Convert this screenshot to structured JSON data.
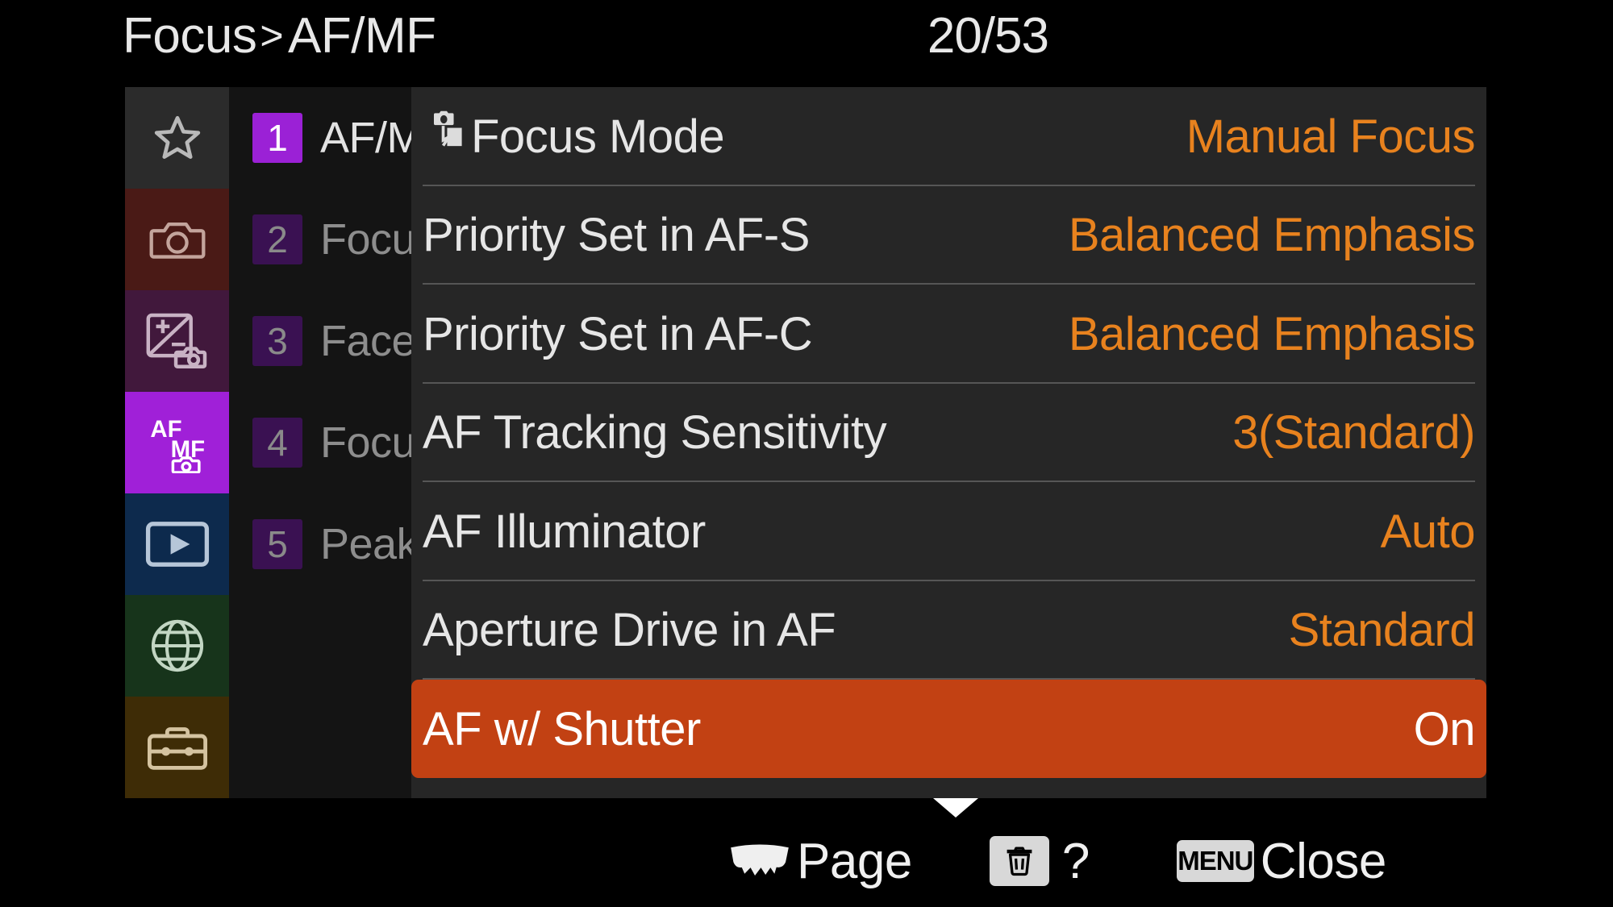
{
  "header": {
    "breadcrumb_root": "Focus",
    "breadcrumb_separator": ">",
    "breadcrumb_current": "AF/MF",
    "page_counter": "20/53",
    "page_current": 20,
    "page_total": 53
  },
  "sidebar": {
    "icons": [
      {
        "name": "favorites-star-icon",
        "glyph": "star",
        "bg": "#2b2b2b",
        "fg": "#b9b9b9",
        "selected": false
      },
      {
        "name": "shooting-camera-icon",
        "glyph": "camera",
        "bg": "#4a1a16",
        "fg": "#c3a49c",
        "selected": false
      },
      {
        "name": "exposure-color-icon",
        "glyph": "exposure",
        "bg": "#41183c",
        "fg": "#c8b2c4",
        "selected": false
      },
      {
        "name": "af-mf-focus-icon",
        "glyph": "afmf",
        "bg": "#a020d8",
        "fg": "#ffffff",
        "selected": true
      },
      {
        "name": "playback-icon",
        "glyph": "playback",
        "bg": "#0d2a4d",
        "fg": "#b6c6d8",
        "selected": false
      },
      {
        "name": "network-globe-icon",
        "glyph": "globe",
        "bg": "#17341b",
        "fg": "#c2d6c3",
        "selected": false
      },
      {
        "name": "setup-toolbox-icon",
        "glyph": "toolbox",
        "bg": "#3e2c06",
        "fg": "#d4c3a0",
        "selected": false
      }
    ],
    "tabs": [
      {
        "number": "1",
        "label": "AF/MF",
        "active": true
      },
      {
        "number": "2",
        "label": "Focus Area",
        "active": false
      },
      {
        "number": "3",
        "label": "Face/Eye AF",
        "active": false
      },
      {
        "number": "4",
        "label": "Focus Assistant",
        "active": false
      },
      {
        "number": "5",
        "label": "Peaking Display",
        "active": false
      }
    ]
  },
  "settings": {
    "rows": [
      {
        "label": "Focus Mode",
        "value": "Manual Focus",
        "icon": "subject-focus-icon",
        "highlight": false
      },
      {
        "label": "Priority Set in AF-S",
        "value": "Balanced Emphasis",
        "icon": null,
        "highlight": false
      },
      {
        "label": "Priority Set in AF-C",
        "value": "Balanced Emphasis",
        "icon": null,
        "highlight": false
      },
      {
        "label": "AF Tracking Sensitivity",
        "value": "3(Standard)",
        "icon": null,
        "highlight": false
      },
      {
        "label": "AF Illuminator",
        "value": "Auto",
        "icon": null,
        "highlight": false
      },
      {
        "label": "Aperture Drive in AF",
        "value": "Standard",
        "icon": null,
        "highlight": false
      },
      {
        "label": "AF w/ Shutter",
        "value": "On",
        "icon": null,
        "highlight": true
      }
    ]
  },
  "bottom_bar": {
    "page_label": "Page",
    "help_label": "?",
    "menu_badge": "MENU",
    "close_label": "Close"
  },
  "colors": {
    "value_orange": "#e8821e",
    "highlight_row": "#c24113",
    "accent_purple": "#a020d8",
    "panel_bg": "#262626",
    "screen_bg": "#000000"
  }
}
